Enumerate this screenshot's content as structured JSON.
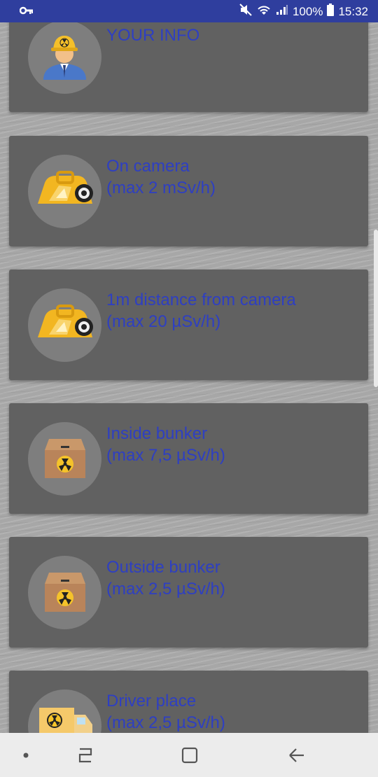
{
  "status_bar": {
    "battery_percent": "100%",
    "time": "15:32",
    "icons": [
      "key-icon",
      "mute-icon",
      "wifi-icon",
      "signal-icon",
      "battery-icon"
    ]
  },
  "cards": [
    {
      "icon": "worker-icon",
      "line1": "YOUR INFO",
      "line2": ""
    },
    {
      "icon": "camera-icon",
      "line1": "On camera",
      "line2": "(max 2 mSv/h)"
    },
    {
      "icon": "camera-icon",
      "line1": "1m distance from camera",
      "line2": "(max 20 µSv/h)"
    },
    {
      "icon": "box-icon",
      "line1": "Inside bunker",
      "line2": "(max 7,5 µSv/h)"
    },
    {
      "icon": "box-icon",
      "line1": "Outside bunker",
      "line2": "(max 2,5 µSv/h)"
    },
    {
      "icon": "truck-icon",
      "line1": "Driver place",
      "line2": "(max 2,5 µSv/h)"
    }
  ],
  "colors": {
    "status_bar": "#2f3e9e",
    "card": "#616161",
    "text": "#2e3fc2",
    "nav_bar": "#ececec"
  },
  "nav_bar": {
    "icons": [
      "dot-icon",
      "recents-icon",
      "home-icon",
      "back-icon"
    ]
  }
}
